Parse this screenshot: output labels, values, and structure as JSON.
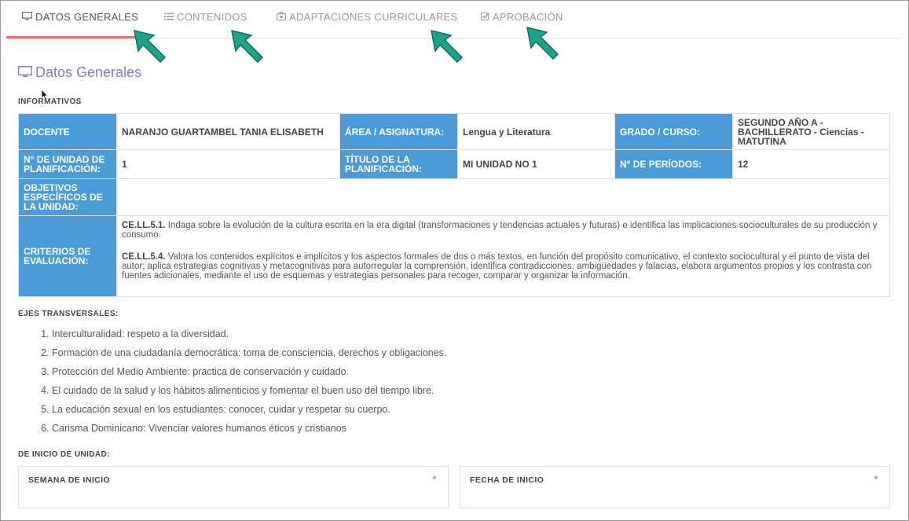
{
  "tabs": [
    {
      "label": "DATOS GENERALES",
      "icon": "monitor-icon",
      "active": true
    },
    {
      "label": "CONTENIDOS",
      "icon": "list-icon"
    },
    {
      "label": "ADAPTACIONES CURRICULARES",
      "icon": "briefcase-icon"
    },
    {
      "label": "APROBACIÓN",
      "icon": "check-square-icon"
    }
  ],
  "section_title": "Datos Generales",
  "informativos_label": "INFORMATIVOS",
  "table": {
    "docente_h": "DOCENTE",
    "docente_v": "NARANJO GUARTAMBEL TANIA ELISABETH",
    "area_h": "ÁREA / ASIGNATURA:",
    "area_v": "Lengua y Literatura",
    "grado_h": "GRADO / CURSO:",
    "grado_v": "SEGUNDO AÑO A - BACHILLERATO - Ciencias - MATUTINA",
    "unidad_h": "N° DE UNIDAD DE PLANIFICACIÓN:",
    "unidad_v": "1",
    "titulo_h": "TÍTULO DE LA PLANIFICACIÓN:",
    "titulo_v": "MI UNIDAD NO 1",
    "periodos_h": "N° DE PERÍODOS:",
    "periodos_v": "12",
    "objetivos_h": "OBJETIVOS ESPECÍFICOS DE LA UNIDAD:",
    "objetivos_v": "",
    "criterios_h": "CRITERIOS DE EVALUACIÓN:",
    "criterios": [
      {
        "code": "CE.LL.5.1.",
        "text": " Indaga sobre la evolución de la cultura escrita en la era digital (transformaciones y tendencias actuales y futuras) e identifica las implicaciones socioculturales de su producción y consumo."
      },
      {
        "code": "CE.LL.5.4.",
        "text": " Valora los contenidos explícitos e implícitos y los aspectos formales de dos o más textos, en función del propósito comunicativo, el contexto sociocultural y el punto de vista del autor; aplica estrategias cognitivas y metacognitivas para autorregular la comprensión, identifica contradicciones, ambigüedades y falacias, elabora argumentos propios y los contrasta con fuentes adicionales, mediante el uso de esquemas y estrategias personales para recoger, comparar y organizar la información."
      }
    ]
  },
  "ejes_label": "EJES TRANSVERSALES:",
  "ejes": [
    "Interculturalidad: respeto a la diversidad.",
    "Formación de una ciudadanía democrática: toma de consciencia, derechos y obligaciones.",
    "Protección del Medio Ambiente: practica de conservación y cuidado.",
    "El cuidado de la salud y los hábitos alimenticios y fomentar el buen uso del tiempo libre.",
    "La educación sexual en los estudiantes: conocer, cuidar y respetar su cuerpo.",
    "Carisma Dominicano: Vivenciar valores humanos éticos y cristianos"
  ],
  "inicio_label": "DE INICIO DE UNIDAD:",
  "fields": {
    "semana_label": "SEMANA DE INICIO",
    "fecha_label": "FECHA DE INICIO",
    "required_mark": "*"
  },
  "colors": {
    "header_blue": "#4a9bd7",
    "accent_red": "#e4736f",
    "title_purple": "#8a77c9",
    "arrow_teal": "#1aa58a"
  }
}
